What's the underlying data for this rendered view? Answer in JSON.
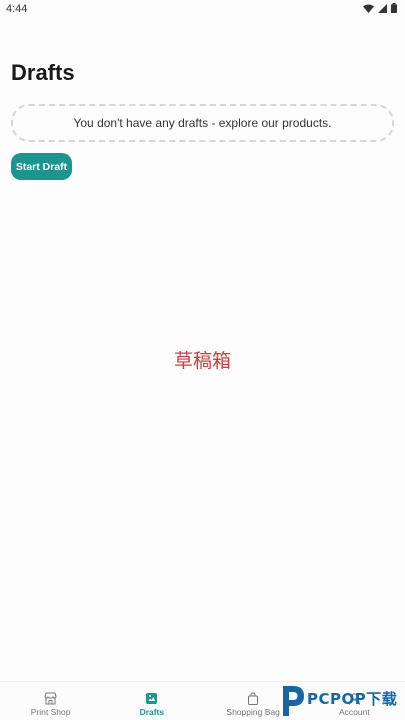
{
  "status_bar": {
    "time": "4:44",
    "icons": [
      "wifi-icon",
      "signal-icon",
      "battery-icon"
    ]
  },
  "page": {
    "title": "Drafts",
    "empty_message": "You don't have any drafts - explore our products.",
    "start_button_label": "Start Draft"
  },
  "overlay_caption": "草稿箱",
  "bottom_nav": {
    "items": [
      {
        "label": "Print Shop",
        "icon": "storefront-icon",
        "active": false
      },
      {
        "label": "Drafts",
        "icon": "drafts-icon",
        "active": true
      },
      {
        "label": "Shopping Bag",
        "icon": "shopping-bag-icon",
        "active": false
      },
      {
        "label": "Account",
        "icon": "account-icon",
        "active": false
      }
    ]
  },
  "watermark": {
    "text": "PCPOP下载"
  },
  "colors": {
    "accent": "#1a9590",
    "caption": "#d23c3c",
    "watermark": "#1565a8"
  }
}
